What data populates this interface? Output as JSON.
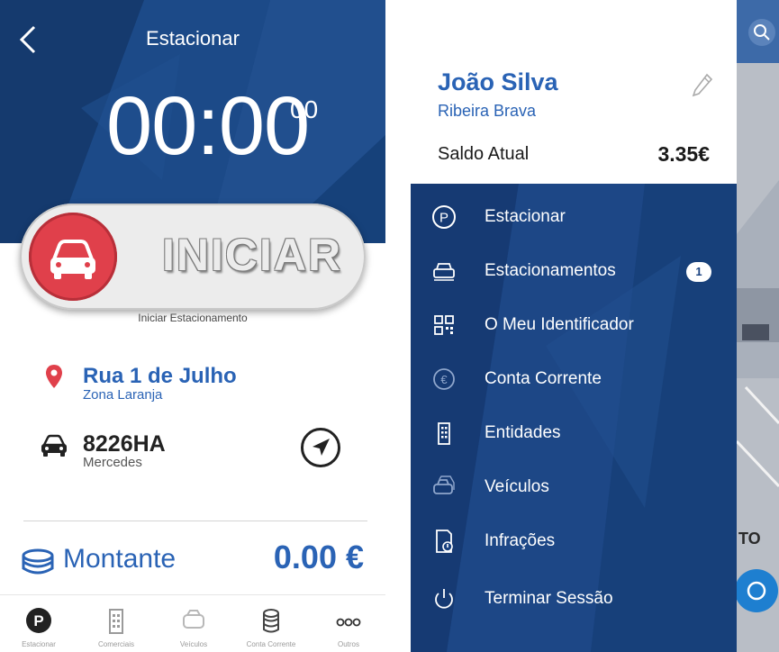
{
  "colors": {
    "primary_blue": "#1a4280",
    "accent_blue": "#2a63b5",
    "start_red": "#e0404b",
    "white": "#ffffff"
  },
  "parking_screen": {
    "title": "Estacionar",
    "timer_main": "00:00",
    "timer_seconds": "00",
    "start_button": "INICIAR",
    "start_caption": "Iniciar Estacionamento",
    "street": "Rua 1 de Julho",
    "zone": "Zona Laranja",
    "plate": "8226HA",
    "brand": "Mercedes",
    "amount_label": "Montante",
    "amount_value": "0.00 €",
    "bottom_nav": [
      {
        "label": "Estacionar",
        "icon": "parking-icon"
      },
      {
        "label": "Comerciais",
        "icon": "building-icon"
      },
      {
        "label": "Veículos",
        "icon": "vehicles-icon"
      },
      {
        "label": "Conta Corrente",
        "icon": "wallet-icon"
      },
      {
        "label": "Outros",
        "icon": "more-icon"
      }
    ]
  },
  "drawer": {
    "user_name": "João Silva",
    "user_city": "Ribeira Brava",
    "balance_label": "Saldo Atual",
    "balance_value": "3.35€",
    "menu": [
      {
        "label": "Estacionar",
        "icon": "parking-icon"
      },
      {
        "label": "Estacionamentos",
        "icon": "parked-car-icon",
        "badge": "1"
      },
      {
        "label": "O Meu Identificador",
        "icon": "qr-code-icon"
      },
      {
        "label": "Conta Corrente",
        "icon": "euro-coin-icon"
      },
      {
        "label": "Entidades",
        "icon": "building-icon"
      },
      {
        "label": "Veículos",
        "icon": "vehicles-icon"
      },
      {
        "label": "Infrações",
        "icon": "infraction-document-icon"
      },
      {
        "label": "Terminar Sessão",
        "icon": "power-icon"
      }
    ]
  }
}
